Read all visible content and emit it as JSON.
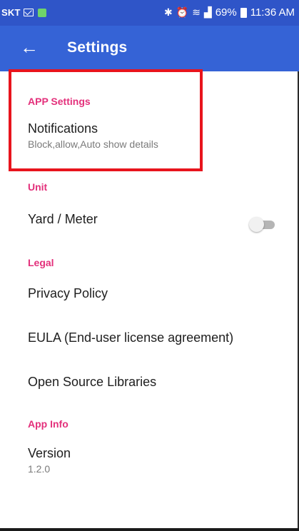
{
  "status_bar": {
    "carrier": "SKT",
    "right_text": "69%",
    "time": "11:36 AM",
    "icons": [
      "mail-icon",
      "app-notification-icon",
      "bluetooth-icon",
      "alarm-icon",
      "wifi-icon",
      "signal-icon",
      "battery-icon"
    ]
  },
  "appbar": {
    "title": "Settings",
    "back_icon": "arrow-left-icon",
    "color": "#3563d6"
  },
  "sections": {
    "app_settings": {
      "header": "APP Settings",
      "notifications": {
        "title": "Notifications",
        "summary": "Block,allow,Auto show details"
      }
    },
    "unit": {
      "header": "Unit",
      "yard_meter": {
        "title": "Yard / Meter",
        "toggle_on": false
      }
    },
    "legal": {
      "header": "Legal",
      "privacy": {
        "title": "Privacy Policy"
      },
      "eula": {
        "title": "EULA (End-user license agreement)"
      },
      "oss": {
        "title": "Open Source Libraries"
      }
    },
    "app_info": {
      "header": "App Info",
      "version": {
        "title": "Version",
        "value": "1.2.0"
      }
    }
  },
  "colors": {
    "accent": "#e3307b",
    "highlight_box": "#e8141d",
    "status_bar": "#2f55c8"
  }
}
